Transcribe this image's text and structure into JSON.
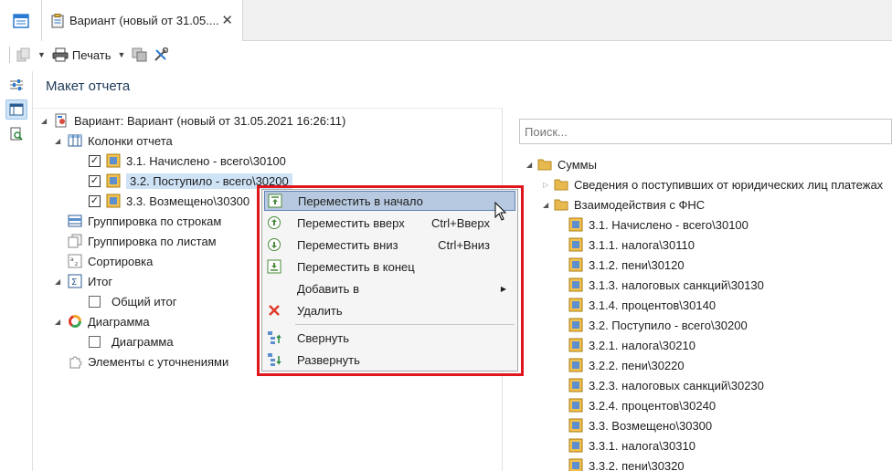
{
  "tabs": {
    "doc_title": "Вариант (новый от 31.05....",
    "close_glyph": "✕"
  },
  "toolbar": {
    "print_label": "Печать"
  },
  "panel": {
    "title": "Макет отчета"
  },
  "left_tree": {
    "root": "Вариант: Вариант (новый от 31.05.2021 16:26:11)",
    "columns_group": "Колонки отчета",
    "columns": [
      {
        "label": "3.1. Начислено - всего\\30100",
        "checked": true
      },
      {
        "label": "3.2. Поступило - всего\\30200",
        "checked": true,
        "selected": true
      },
      {
        "label": "3.3. Возмещено\\30300",
        "checked": true
      }
    ],
    "grouping_rows": "Группировка по строкам",
    "grouping_sheets": "Группировка по листам",
    "sorting": "Сортировка",
    "total": "Итог",
    "total_child": "Общий итог",
    "chart": "Диаграмма",
    "chart_child": "Диаграмма",
    "refinements": "Элементы с уточнениями"
  },
  "context_menu": {
    "items": [
      {
        "label": "Переместить в начало",
        "shortcut": ""
      },
      {
        "label": "Переместить вверх",
        "shortcut": "Ctrl+Вверх"
      },
      {
        "label": "Переместить вниз",
        "shortcut": "Ctrl+Вниз"
      },
      {
        "label": "Переместить в конец",
        "shortcut": ""
      },
      {
        "label": "Добавить в",
        "shortcut": ""
      },
      {
        "label": "Удалить",
        "shortcut": ""
      },
      {
        "label": "Свернуть",
        "shortcut": ""
      },
      {
        "label": "Развернуть",
        "shortcut": ""
      }
    ]
  },
  "right_panel": {
    "search_placeholder": "Поиск...",
    "root": "Суммы",
    "folder1": "Сведения о поступивших от юридических лиц платежах",
    "folder2": "Взаимодействия с ФНС",
    "items": [
      "3.1. Начислено - всего\\30100",
      "3.1.1. налога\\30110",
      "3.1.2. пени\\30120",
      "3.1.3. налоговых санкций\\30130",
      "3.1.4. процентов\\30140",
      "3.2. Поступило - всего\\30200",
      "3.2.1. налога\\30210",
      "3.2.2. пени\\30220",
      "3.2.3. налоговых санкций\\30230",
      "3.2.4. процентов\\30240",
      "3.3. Возмещено\\30300",
      "3.3.1. налога\\30310",
      "3.3.2. пени\\30320"
    ]
  },
  "colors": {
    "accent_red": "#e0161c",
    "selection": "#cfe3f7",
    "menu_hover": "#b7c9e0"
  }
}
